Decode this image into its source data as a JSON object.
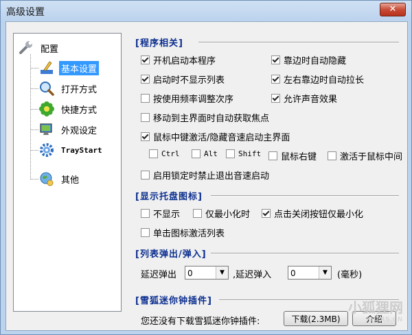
{
  "window": {
    "title": "高级设置",
    "close_glyph": "✕"
  },
  "tree": {
    "root": "配置",
    "items": [
      {
        "label": "基本设置",
        "icon": "brush-icon"
      },
      {
        "label": "打开方式",
        "icon": "magnifier-icon"
      },
      {
        "label": "快捷方式",
        "icon": "flower-icon"
      },
      {
        "label": "外观设定",
        "icon": "monitor-icon"
      },
      {
        "label": "TrayStart",
        "icon": "gear-icon"
      },
      {
        "label": "其他",
        "icon": "globe-icon"
      }
    ]
  },
  "program": {
    "title": "[程序相关]",
    "startup": "开机启动本程序",
    "edge_hide": "靠边时自动隐藏",
    "no_list": "启动时不显示列表",
    "edge_stretch": "左右靠边时自动拉长",
    "freq_order": "按使用频率调整次序",
    "sound": "允许声音效果",
    "auto_focus": "移动到主界面时自动获取焦点",
    "middle_click": "鼠标中键激活/隐藏音速启动主界面",
    "ctrl": "Ctrl",
    "alt": "Alt",
    "shift": "Shift",
    "right_button": "鼠标右键",
    "at_middle": "激活于鼠标中间",
    "lock_disable": "启用锁定时禁止退出音速启动"
  },
  "tray": {
    "title": "[显示托盘图标]",
    "hide": "不显示",
    "min_only": "仅最小化时",
    "close_min": "点击关闭按钮仅最小化",
    "click_activate": "单击图标激活列表"
  },
  "popup": {
    "title": "[列表弹出/弹入]",
    "delay_out": "延迟弹出",
    "out_value": "0",
    "delay_in": ",延迟弹入",
    "in_value": "0",
    "unit": "(毫秒)"
  },
  "clock": {
    "title": "[雪狐迷你钟插件]",
    "notice": "您还没有下载雪狐迷你钟插件:",
    "download_btn": "下载(2.3MB)",
    "intro_btn": "介绍"
  },
  "watermark": {
    "text": "小狐狸网",
    "sub": "XHLRS.CN"
  }
}
